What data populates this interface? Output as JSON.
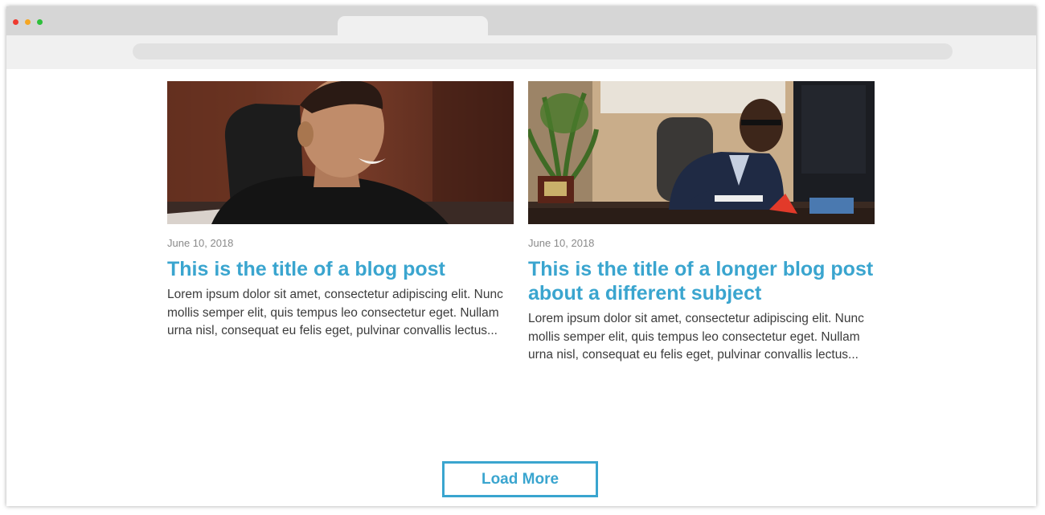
{
  "posts": [
    {
      "image_alt": "photo-man-smiling-office",
      "date": "June 10, 2018",
      "title": "This is the title of a blog post",
      "excerpt": "Lorem ipsum dolor sit amet, consectetur adipiscing elit. Nunc mollis semper elit, quis tempus leo consectetur eget. Nullam urna nisl, consequat eu felis eget, pulvinar convallis lectus..."
    },
    {
      "image_alt": "photo-man-on-phone-at-desk",
      "date": "June 10, 2018",
      "title": "This is the title of a longer blog post about a different subject",
      "excerpt": "Lorem ipsum dolor sit amet, consectetur adipiscing elit. Nunc mollis semper elit, quis tempus leo consectetur eget. Nullam urna nisl, consequat eu felis eget, pulvinar convallis lectus..."
    }
  ],
  "load_more": {
    "label": "Load More"
  },
  "colors": {
    "accent": "#3aa5cf",
    "body_text": "#3c3c3c",
    "date_text": "#8a8a8a"
  }
}
